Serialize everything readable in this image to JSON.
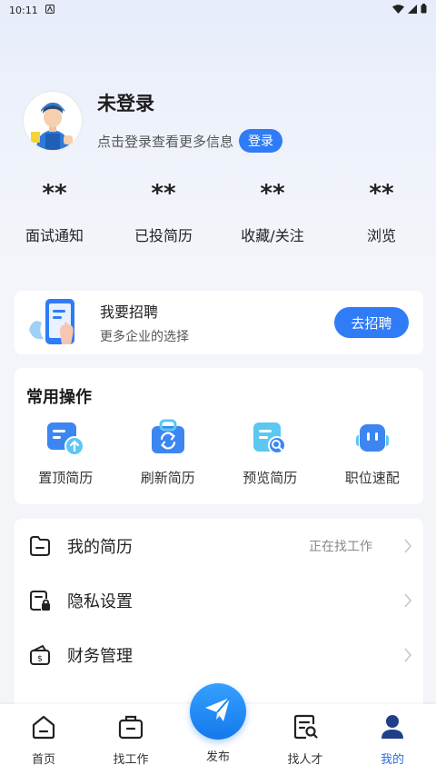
{
  "status": {
    "time": "10:11"
  },
  "profile": {
    "name": "未登录",
    "subtitle": "点击登录查看更多信息",
    "login_label": "登录"
  },
  "stats": [
    {
      "value": "**",
      "label": "面试通知"
    },
    {
      "value": "**",
      "label": "已投简历"
    },
    {
      "value": "**",
      "label": "收藏/关注"
    },
    {
      "value": "**",
      "label": "浏览"
    }
  ],
  "recruit": {
    "title": "我要招聘",
    "subtitle": "更多企业的选择",
    "button": "去招聘"
  },
  "common": {
    "title": "常用操作",
    "items": [
      {
        "label": "置顶简历",
        "icon": "resume-top-icon"
      },
      {
        "label": "刷新简历",
        "icon": "refresh-resume-icon"
      },
      {
        "label": "预览简历",
        "icon": "preview-resume-icon"
      },
      {
        "label": "职位速配",
        "icon": "job-match-icon"
      }
    ]
  },
  "menu": [
    {
      "label": "我的简历",
      "value": "正在找工作",
      "icon": "folder-icon"
    },
    {
      "label": "隐私设置",
      "value": "",
      "icon": "privacy-lock-icon"
    },
    {
      "label": "财务管理",
      "value": "",
      "icon": "wallet-icon"
    }
  ],
  "tabs": [
    {
      "label": "首页",
      "icon": "home-icon"
    },
    {
      "label": "找工作",
      "icon": "briefcase-icon"
    },
    {
      "label": "发布",
      "icon": "paper-plane-icon"
    },
    {
      "label": "找人才",
      "icon": "search-talent-icon"
    },
    {
      "label": "我的",
      "icon": "user-icon"
    }
  ],
  "colors": {
    "accent": "#2f7cf6",
    "active_tab": "#2f6ee6"
  }
}
